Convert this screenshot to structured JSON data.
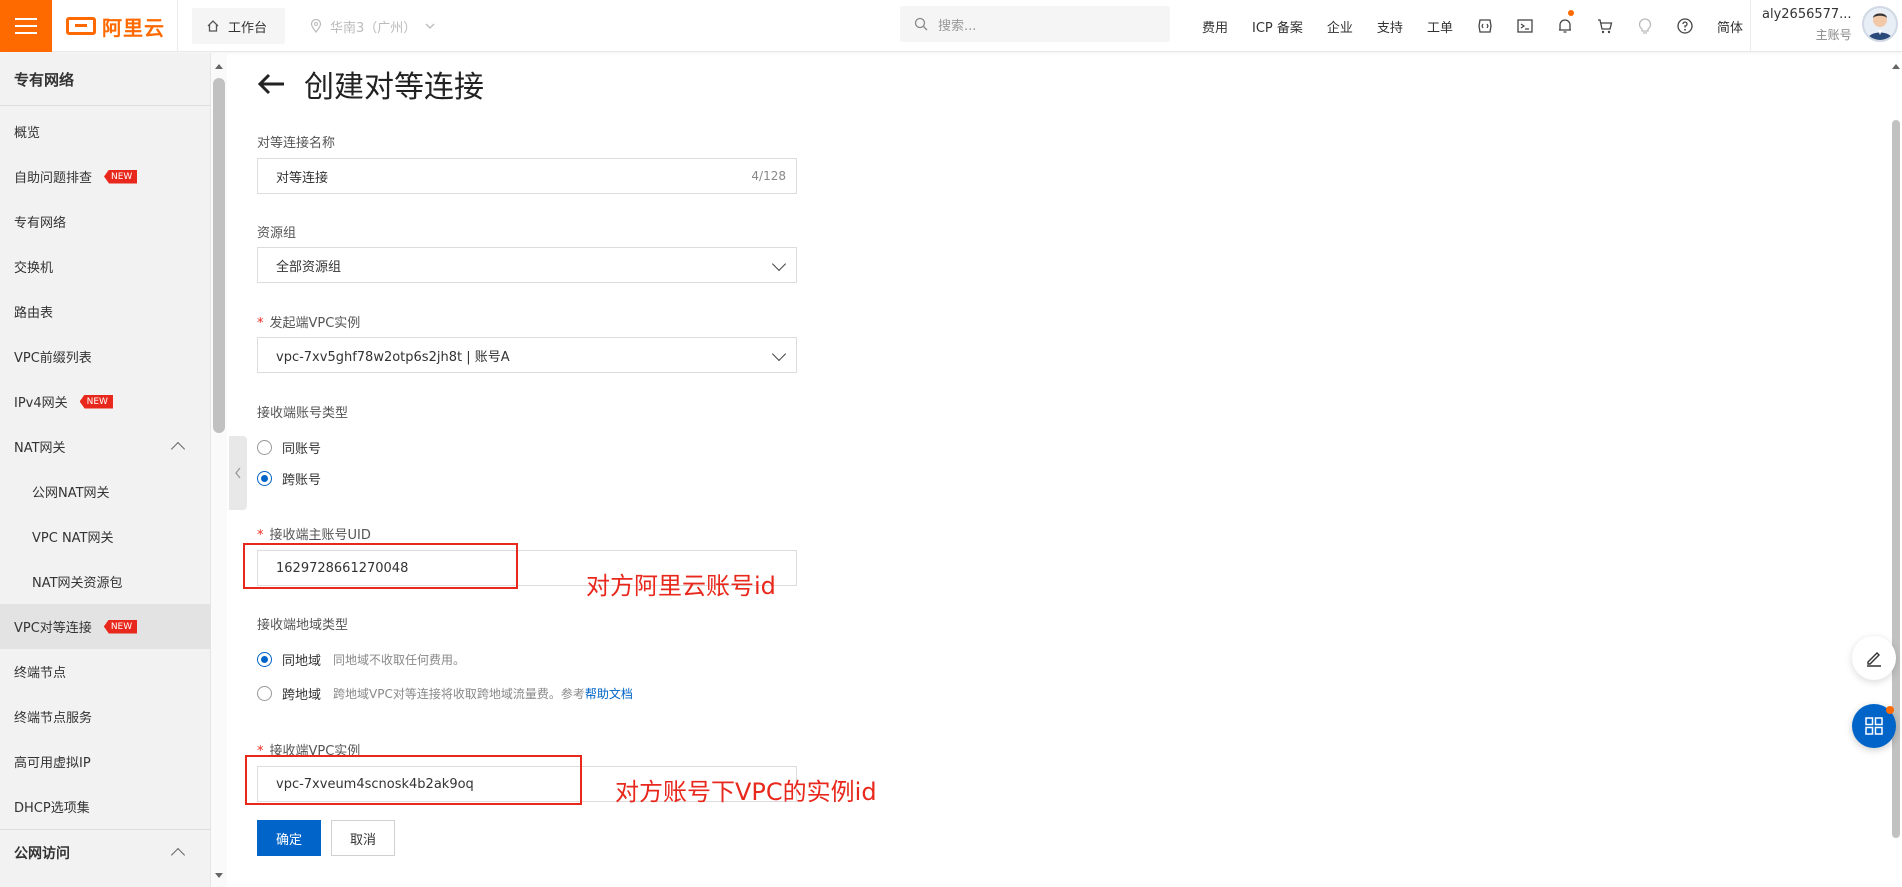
{
  "header": {
    "logo_text": "阿里云",
    "workbench_label": "工作台",
    "region_label": "华南3（广州）",
    "search_placeholder": "搜索...",
    "links": [
      "费用",
      "ICP 备案",
      "企业",
      "支持",
      "工单"
    ],
    "lang_label": "简体",
    "account_name": "aly2656577...",
    "account_type": "主账号"
  },
  "sidebar": {
    "title": "专有网络",
    "items": [
      {
        "label": "概览"
      },
      {
        "label": "自助问题排查",
        "badge": "NEW"
      },
      {
        "label": "专有网络"
      },
      {
        "label": "交换机"
      },
      {
        "label": "路由表"
      },
      {
        "label": "VPC前缀列表"
      },
      {
        "label": "IPv4网关",
        "badge": "NEW"
      },
      {
        "label": "NAT网关"
      },
      {
        "label": "公网NAT网关"
      },
      {
        "label": "VPC NAT网关"
      },
      {
        "label": "NAT网关资源包"
      },
      {
        "label": "VPC对等连接",
        "badge": "NEW"
      },
      {
        "label": "终端节点"
      },
      {
        "label": "终端节点服务"
      },
      {
        "label": "高可用虚拟IP"
      },
      {
        "label": "DHCP选项集"
      },
      {
        "label": "公网访问"
      }
    ]
  },
  "form": {
    "page_title": "创建对等连接",
    "name_label": "对等连接名称",
    "name_value": "对等连接",
    "name_counter": "4/128",
    "resource_group_label": "资源组",
    "resource_group_value": "全部资源组",
    "origin_vpc_label": "发起端VPC实例",
    "origin_vpc_value": "vpc-7xv5ghf78w2otp6s2jh8t | 账号A",
    "account_type_label": "接收端账号类型",
    "account_type_options": [
      "同账号",
      "跨账号"
    ],
    "account_type_selected": "跨账号",
    "receiver_uid_label": "接收端主账号UID",
    "receiver_uid_value": "1629728661270048",
    "region_type_label": "接收端地域类型",
    "region_same_label": "同地域",
    "region_same_hint": "同地域不收取任何费用。",
    "region_cross_label": "跨地域",
    "region_cross_hint": "跨地域VPC对等连接将收取跨地域流量费。参考",
    "help_link": "帮助文档",
    "receiver_vpc_label": "接收端VPC实例",
    "receiver_vpc_value": "vpc-7xveum4scnosk4b2ak9oq",
    "confirm_label": "确定",
    "cancel_label": "取消"
  },
  "annotations": {
    "uid_note": "对方阿里云账号id",
    "vpc_note": "对方账号下VPC的实例id",
    "color": "#e8281c"
  },
  "colors": {
    "brand": "#ff6a00",
    "primary": "#0064c8"
  }
}
